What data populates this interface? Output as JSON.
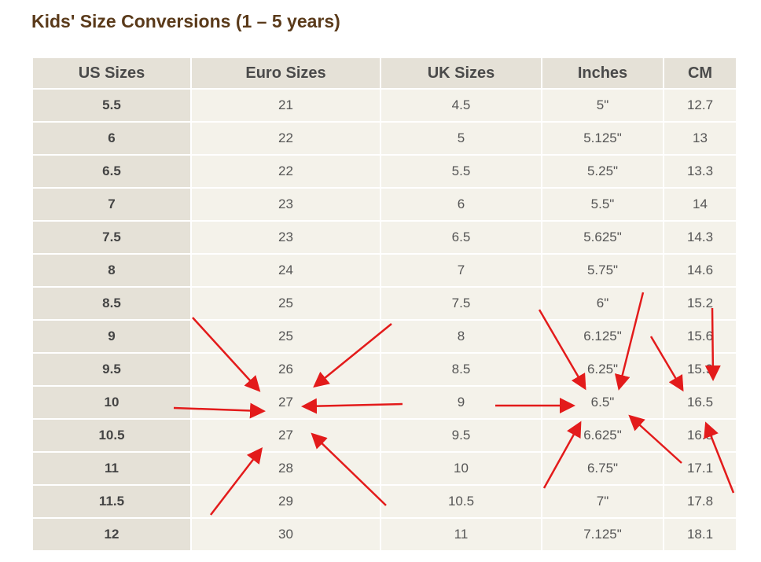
{
  "title": "Kids' Size Conversions (1 – 5 years)",
  "columns": [
    "US Sizes",
    "Euro Sizes",
    "UK Sizes",
    "Inches",
    "CM"
  ],
  "rows": [
    [
      "5.5",
      "21",
      "4.5",
      "5\"",
      "12.7"
    ],
    [
      "6",
      "22",
      "5",
      "5.125\"",
      "13"
    ],
    [
      "6.5",
      "22",
      "5.5",
      "5.25\"",
      "13.3"
    ],
    [
      "7",
      "23",
      "6",
      "5.5\"",
      "14"
    ],
    [
      "7.5",
      "23",
      "6.5",
      "5.625\"",
      "14.3"
    ],
    [
      "8",
      "24",
      "7",
      "5.75\"",
      "14.6"
    ],
    [
      "8.5",
      "25",
      "7.5",
      "6\"",
      "15.2"
    ],
    [
      "9",
      "25",
      "8",
      "6.125\"",
      "15.6"
    ],
    [
      "9.5",
      "26",
      "8.5",
      "6.25\"",
      "15.9"
    ],
    [
      "10",
      "27",
      "9",
      "6.5\"",
      "16.5"
    ],
    [
      "10.5",
      "27",
      "9.5",
      "6.625\"",
      "16.8"
    ],
    [
      "11",
      "28",
      "10",
      "6.75\"",
      "17.1"
    ],
    [
      "11.5",
      "29",
      "10.5",
      "7\"",
      "17.8"
    ],
    [
      "12",
      "30",
      "11",
      "7.125\"",
      "18.1"
    ]
  ],
  "colors": {
    "title": "#5a3a1a",
    "header_bg": "#e5e1d7",
    "cell_bg": "#f4f2ea",
    "arrow": "#e31b1b"
  }
}
